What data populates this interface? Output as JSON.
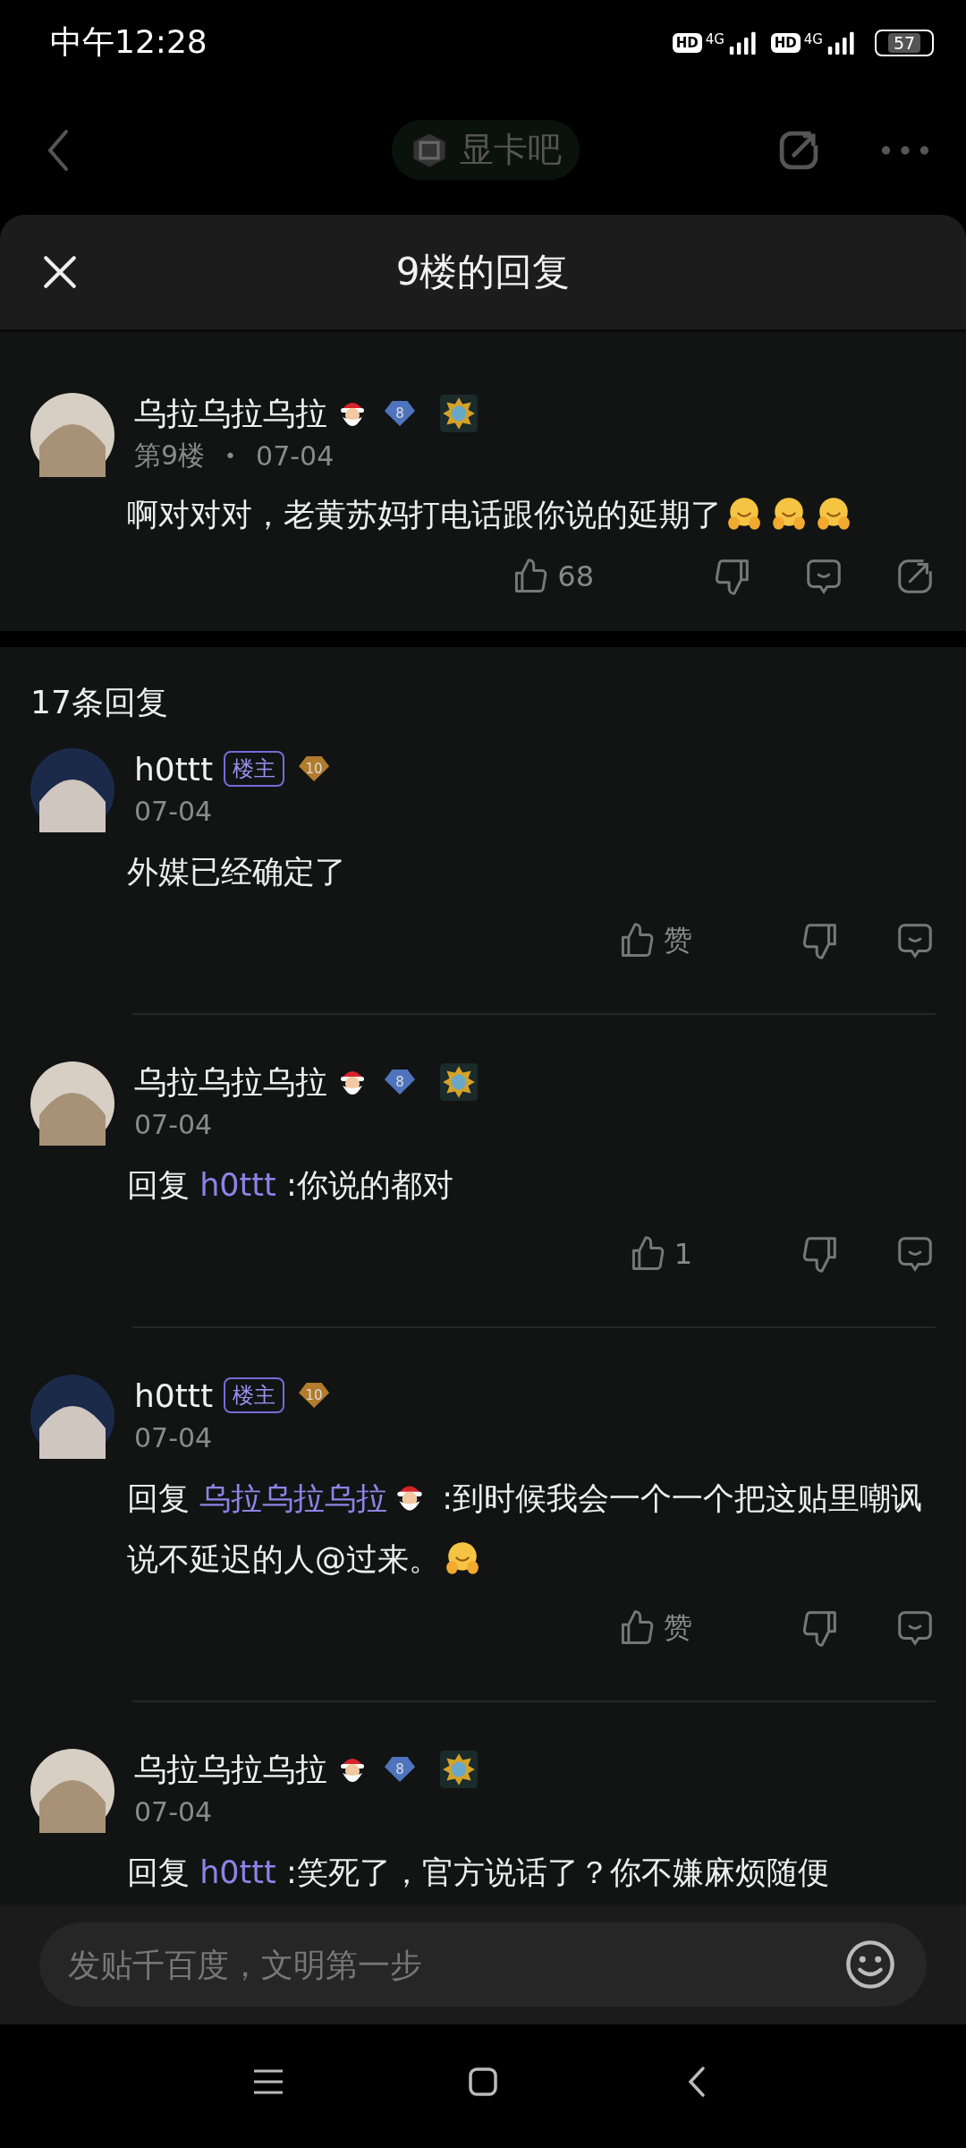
{
  "status_bar": {
    "time": "中午12:28",
    "network": [
      {
        "hd": "HD",
        "type": "4G"
      },
      {
        "hd": "HD",
        "type": "4G"
      }
    ],
    "battery": "57"
  },
  "top_nav": {
    "forum": "显卡吧"
  },
  "sheet": {
    "title": "9楼的回复"
  },
  "main_comment": {
    "author": {
      "name": "乌拉乌拉乌拉",
      "santa": true,
      "level": {
        "text": "8",
        "color": "#4f74bd"
      },
      "medal": true
    },
    "floor": "第9楼",
    "separator": "•",
    "date": "07-04",
    "body": [
      {
        "kind": "text",
        "text": "啊对对对，老黄苏妈打电话跟你说的延期了"
      },
      {
        "kind": "hug"
      },
      {
        "kind": "hug"
      },
      {
        "kind": "hug"
      }
    ],
    "like_count": "68"
  },
  "reply_count": "17条回复",
  "replies": [
    {
      "author": {
        "name": "h0ttt",
        "santa": false,
        "op": true,
        "op_label": "楼主",
        "level": {
          "text": "10",
          "color": "#b27c2c"
        },
        "medal": false
      },
      "date": "07-04",
      "body": [
        {
          "kind": "text",
          "text": "外媒已经确定了"
        }
      ],
      "like_label": "赞"
    },
    {
      "author": {
        "name": "乌拉乌拉乌拉",
        "santa": true,
        "op": false,
        "level": {
          "text": "8",
          "color": "#4f74bd"
        },
        "medal": true
      },
      "date": "07-04",
      "body": [
        {
          "kind": "text",
          "text": "回复 "
        },
        {
          "kind": "mention",
          "text": "h0ttt"
        },
        {
          "kind": "text",
          "text": "  :你说的都对"
        }
      ],
      "like_label": "1"
    },
    {
      "author": {
        "name": "h0ttt",
        "santa": false,
        "op": true,
        "op_label": "楼主",
        "level": {
          "text": "10",
          "color": "#b27c2c"
        },
        "medal": false
      },
      "date": "07-04",
      "body": [
        {
          "kind": "text",
          "text": "回复 "
        },
        {
          "kind": "mention",
          "text": "乌拉乌拉乌拉"
        },
        {
          "kind": "santa"
        },
        {
          "kind": "text",
          "text": "  :到时候我会一个一个把这贴里嘲讽说不延迟的人@过来。"
        },
        {
          "kind": "hug"
        }
      ],
      "like_label": "赞"
    },
    {
      "author": {
        "name": "乌拉乌拉乌拉",
        "santa": true,
        "op": false,
        "level": {
          "text": "8",
          "color": "#4f74bd"
        },
        "medal": true
      },
      "date": "07-04",
      "body": [
        {
          "kind": "text",
          "text": "回复 "
        },
        {
          "kind": "mention",
          "text": "h0ttt"
        },
        {
          "kind": "text",
          "text": "  :笑死了，官方说话了？你不嫌麻烦随便"
        }
      ]
    }
  ],
  "composer": {
    "placeholder": "发贴千百度，文明第一步"
  }
}
